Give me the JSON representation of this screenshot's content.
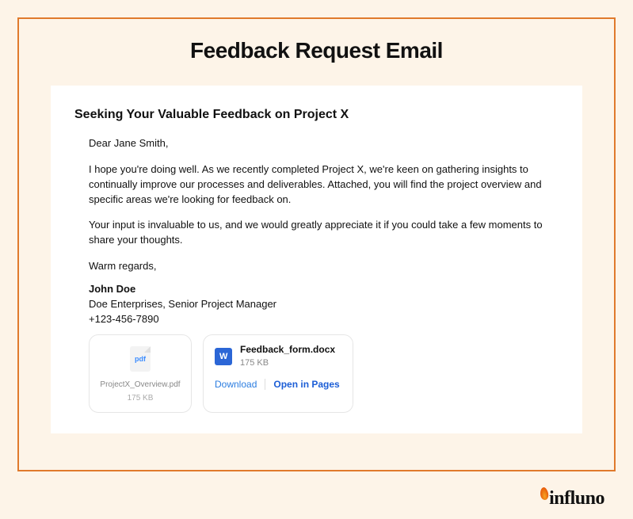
{
  "page_title": "Feedback Request Email",
  "email": {
    "subject": "Seeking Your Valuable Feedback on Project X",
    "greeting": "Dear Jane Smith,",
    "paragraph1": "I hope you're doing well. As we recently completed Project X, we're keen on gathering insights to continually improve our processes and deliverables. Attached, you will find the project overview and specific areas we're looking for feedback on.",
    "paragraph2": "Your input is invaluable to us, and we would greatly appreciate it if you could take a few moments to share your thoughts.",
    "signoff": "Warm regards,",
    "signature": {
      "name": "John Doe",
      "title_line": "Doe Enterprises, Senior Project Manager",
      "phone": "+123-456-7890"
    }
  },
  "attachments": [
    {
      "icon_label": "pdf",
      "filename": "ProjectX_Overview.pdf",
      "size": "175 KB"
    },
    {
      "icon_label": "W",
      "filename": "Feedback_form.docx",
      "size": "175 KB",
      "actions": {
        "download": "Download",
        "open": "Open in Pages"
      }
    }
  ],
  "brand": "influno"
}
